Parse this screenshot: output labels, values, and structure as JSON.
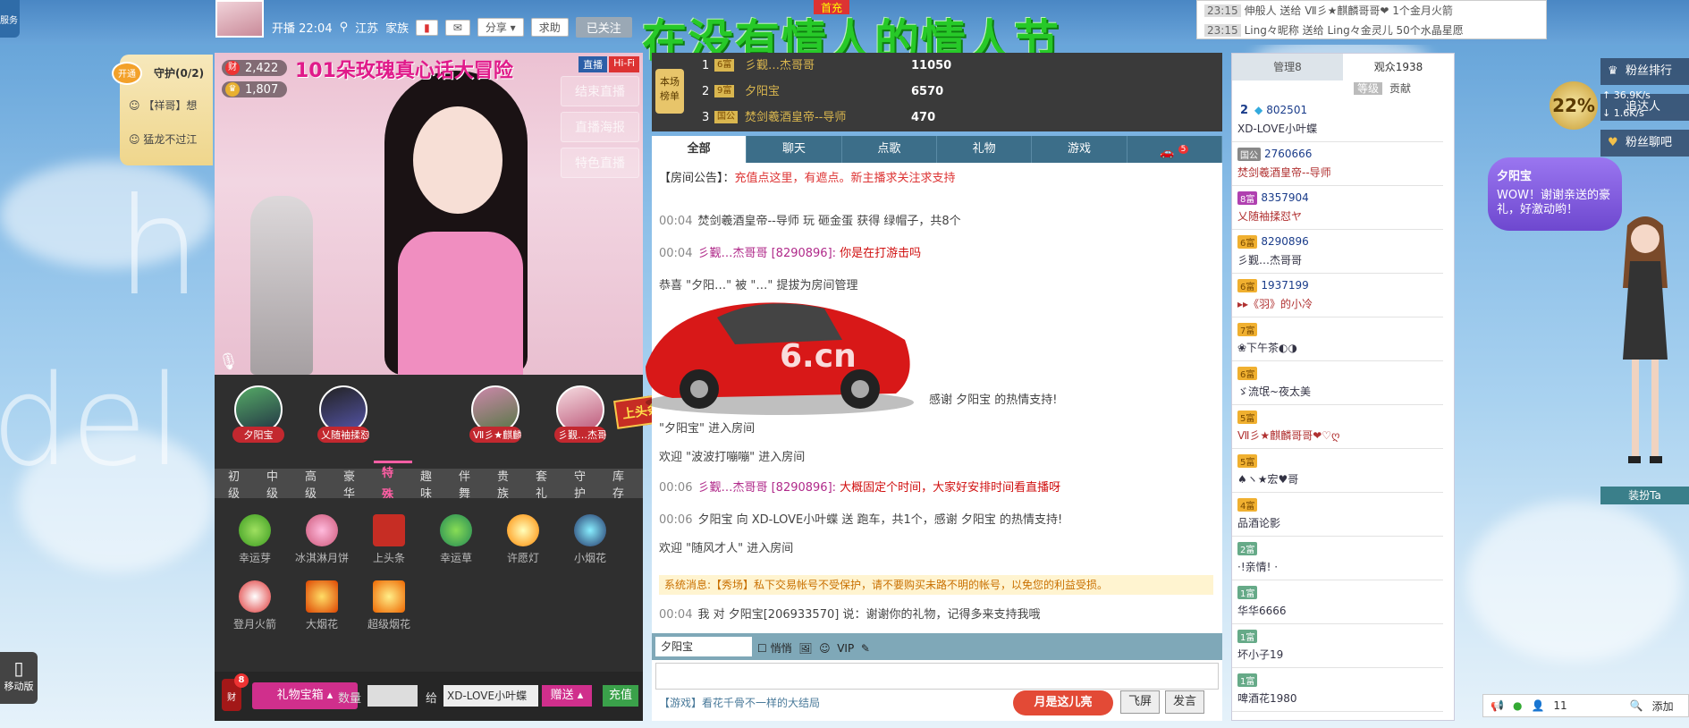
{
  "top": {
    "service_tab": "服务",
    "broadcast_time": "开播 22:04",
    "location": "江苏",
    "family_label": "家族",
    "share_label": "分享",
    "help_label": "求助",
    "follow_label": "已关注",
    "banner_text": "在没有情人的情人节",
    "first_badge": "首充",
    "feed": [
      {
        "time": "23:15",
        "text": "伸般人 送给 Ⅶ彡★麒麟哥哥❤ 1个金月火箭"
      },
      {
        "time": "23:15",
        "text": "Ling々昵称 送给 Ling々金灵儿 50个水晶星愿"
      }
    ]
  },
  "guard": {
    "open_label": "开通",
    "title": "守护(0/2)",
    "items": [
      "【祥哥】想",
      "猛龙不过江"
    ]
  },
  "video": {
    "title": "101朵玫瑰真心话大冒险",
    "badge_live": "直播",
    "badge_hifi": "Hi-Fi",
    "stat1": "2,422",
    "stat2": "1,807",
    "buttons": [
      "结束直播",
      "直播海报",
      "特色直播"
    ]
  },
  "fans": {
    "names": [
      "夕阳宝",
      "乂随袖揉怼",
      "Ⅶ彡★麒麟",
      "彡觐…杰哥"
    ],
    "headline_badge": "上头条"
  },
  "gift_tabs": [
    "初级",
    "中级",
    "高级",
    "豪华",
    "特殊",
    "趣味",
    "伴舞",
    "贵族",
    "套礼",
    "守护",
    "库存"
  ],
  "gift_tab_active": "特殊",
  "gifts": [
    "幸运芽",
    "冰淇淋月饼",
    "上头条",
    "幸运草",
    "许愿灯",
    "小烟花",
    "登月火箭",
    "大烟花",
    "超级烟花"
  ],
  "gift_bar": {
    "count": "8",
    "box_label": "礼物宝箱",
    "qty_label": "数量",
    "to_label": "给",
    "recipient": "XD-LOVE小叶蝶",
    "send_label": "赠送",
    "charge_label": "充值",
    "mobile_label": "移动版"
  },
  "rank": {
    "tag": "本场榜单",
    "rows": [
      {
        "n": "1",
        "lv": "6富",
        "name": "彡觐…杰哥哥",
        "score": "11050"
      },
      {
        "n": "2",
        "lv": "9富",
        "name": "夕阳宝",
        "score": "6570"
      },
      {
        "n": "3",
        "lv": "国公",
        "name": "焚剑羲酒皇帝--导师",
        "score": "470"
      }
    ]
  },
  "chat": {
    "tabs": [
      "全部",
      "聊天",
      "点歌",
      "礼物",
      "游戏",
      "5"
    ],
    "announcement_label": "【房间公告】：",
    "announcement": "充值点这里，有遮点。新主播求关注求支持",
    "messages": [
      {
        "time": "00:04",
        "text": "焚剑羲酒皇帝--导师 玩 砸金蛋 获得 绿帽子，共8个"
      },
      {
        "time": "00:04",
        "user": "彡觐…杰哥哥 [8290896]:",
        "text": "你是在打游击吗"
      },
      {
        "time": "",
        "text": "恭喜 \"夕阳…\" 被 \"…\" 提拔为房间管理"
      },
      {
        "time": "",
        "text": "感谢 夕阳宝 的热情支持!"
      },
      {
        "time": "",
        "text": "\"夕阳宝\" 进入房间"
      },
      {
        "time": "",
        "text": "欢迎 \"波波打嘣嘣\" 进入房间"
      },
      {
        "time": "00:06",
        "user": "彡觐…杰哥哥 [8290896]:",
        "text": "大概固定个时间，大家好安排时间看直播呀"
      },
      {
        "time": "00:06",
        "text": "夕阳宝 向 XD-LOVE小叶蝶 送 跑车，共1个，感谢 夕阳宝 的热情支持!"
      },
      {
        "time": "",
        "text": "欢迎 \"随风才人\" 进入房间"
      }
    ],
    "system": "系统消息:【秀场】私下交易帐号不受保护，请不要购买未路不明的帐号，以免您的利益受损。",
    "last_time": "00:04",
    "last_msg": "我 对 夕阳宝[206933570] 说：谢谢你的礼物，记得多来支持我哦",
    "input_target": "夕阳宝",
    "quiet_label": "悄悄",
    "bottom_hint": "【游戏】看花千骨不一样的大结局",
    "month_btn": "月是这儿亮",
    "fly_btn": "飞屏",
    "post_btn": "发言"
  },
  "userlist": {
    "tab_admin": "管理8",
    "tab_viewers": "观众1938",
    "sub_level": "等级",
    "sub_contrib": "贡献",
    "users": [
      {
        "lv": "2",
        "id": "802501",
        "name": "XD-LOVE小叶蝶"
      },
      {
        "lv": "国公",
        "id": "2760666",
        "name": "焚剑羲酒皇帝--导师"
      },
      {
        "lv": "8富",
        "id": "8357904",
        "name": "乂随袖揉怼ヤ"
      },
      {
        "lv": "6富",
        "id": "8290896",
        "name": "彡觐…杰哥哥"
      },
      {
        "lv": "6富",
        "id": "1937199",
        "name": "▸▸《羽》的小冷"
      },
      {
        "lv": "7富",
        "id": "",
        "name": "❀下午茶◐◑"
      },
      {
        "lv": "6富",
        "id": "",
        "name": "ゞ流氓~夜太美"
      },
      {
        "lv": "5富",
        "id": "",
        "name": "Ⅶ彡★麒麟哥哥❤♡ღ"
      },
      {
        "lv": "5富",
        "id": "",
        "name": "♠ヽ★宏♥哥"
      },
      {
        "lv": "4富",
        "id": "",
        "name": "品酒论影"
      },
      {
        "lv": "2富",
        "id": "",
        "name": "·!亲情! ·"
      },
      {
        "lv": "1富",
        "id": "",
        "name": "华华6666"
      },
      {
        "lv": "1富",
        "id": "",
        "name": "坏小子19"
      },
      {
        "lv": "1富",
        "id": "",
        "name": "啤酒花1980"
      }
    ]
  },
  "side": {
    "fan_rank": "粉丝排行",
    "reach": "追达人",
    "fan_chat": "粉丝聊吧",
    "percent": "22%",
    "speed_up": "36.9K/s",
    "speed_down": "1.6K/s",
    "bubble_name": "夕阳宝",
    "bubble_text": "WOW！谢谢亲送的豪礼，好激动哟！",
    "dress_label": "装扮Ta",
    "status_count": "11",
    "status_add": "添加"
  }
}
